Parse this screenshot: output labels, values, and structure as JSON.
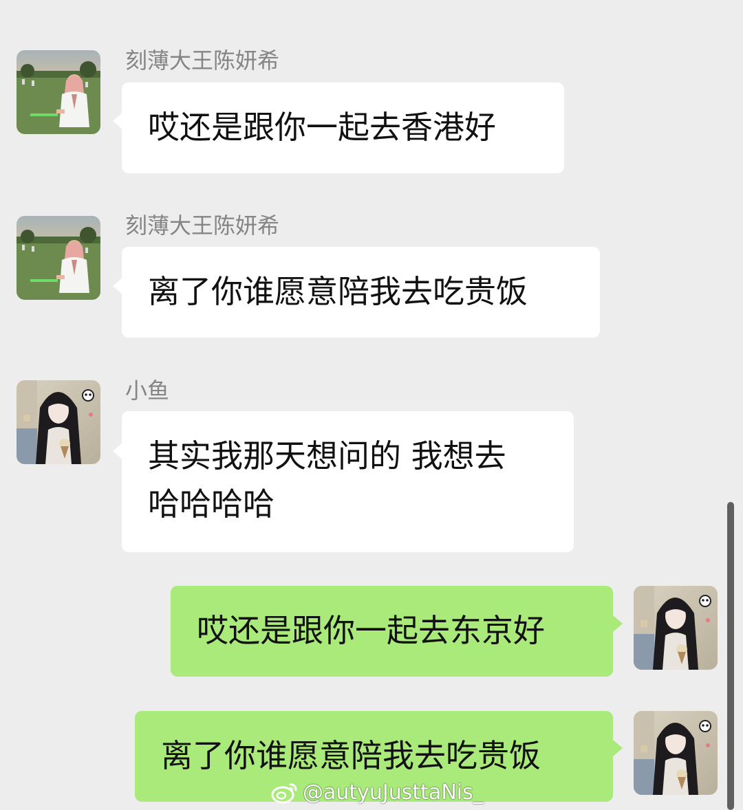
{
  "chat": {
    "messages": [
      {
        "sender": "刻薄大王陈妍希",
        "text": "哎还是跟你一起去香港好",
        "side": "in",
        "avatar": "outdoor-park-avatar"
      },
      {
        "sender": "刻薄大王陈妍希",
        "text": "离了你谁愿意陪我去吃贵饭",
        "side": "in",
        "avatar": "outdoor-park-avatar"
      },
      {
        "sender": "小鱼",
        "text_lines": [
          "其实我那天想问的 我想去",
          "哈哈哈哈"
        ],
        "side": "in",
        "avatar": "girl-long-hair-avatar"
      },
      {
        "text": "哎还是跟你一起去东京好",
        "side": "out",
        "avatar": "girl-long-hair-avatar"
      },
      {
        "text": "离了你谁愿意陪我去吃贵饭",
        "side": "out",
        "avatar": "girl-long-hair-avatar"
      }
    ]
  },
  "watermark": {
    "text": "@autyuJusttaNis_",
    "icon": "weibo-logo-icon"
  },
  "colors": {
    "background": "#ededed",
    "incoming_bubble": "#ffffff",
    "outgoing_bubble": "#a9ea7a",
    "sender_name": "#858585"
  }
}
